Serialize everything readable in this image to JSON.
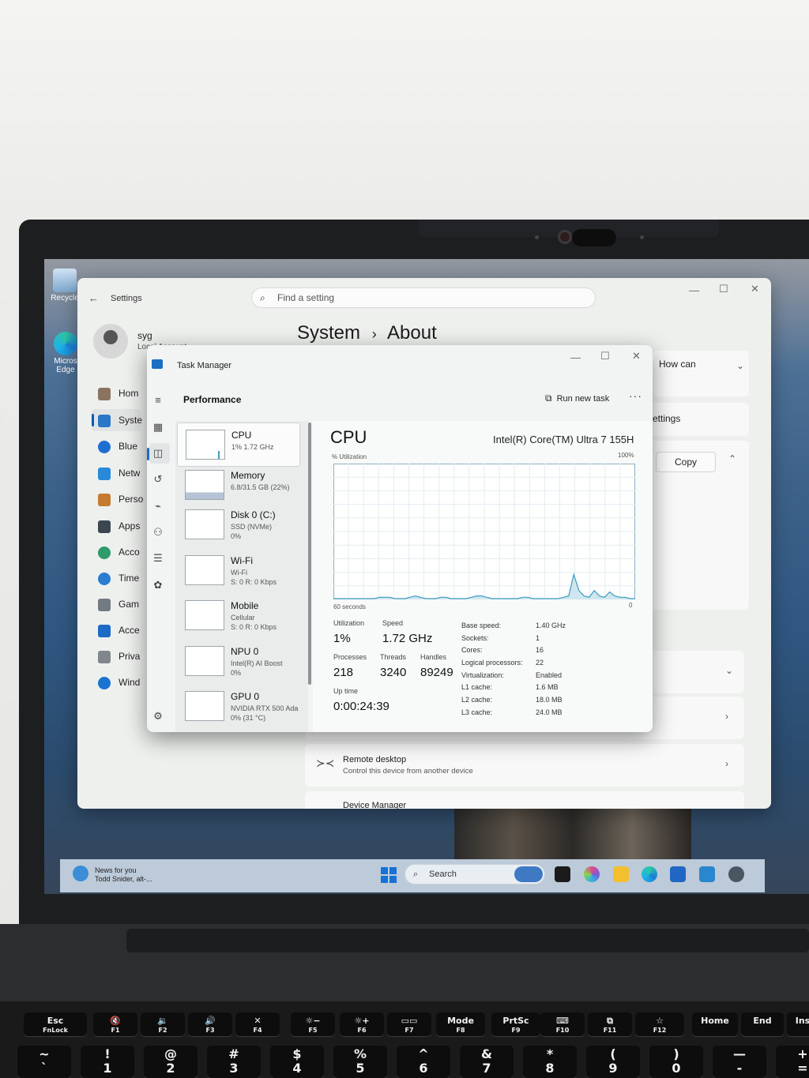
{
  "desktop": {
    "icons": [
      {
        "label": "Recycle",
        "icon": "recycle-bin-icon"
      },
      {
        "label": "Micros Edge",
        "icon": "edge-icon"
      }
    ]
  },
  "settings": {
    "title": "Settings",
    "search_placeholder": "Find a setting",
    "user_name": "syg",
    "user_sub": "Local Account",
    "breadcrumb_parent": "System",
    "breadcrumb_sep": "›",
    "breadcrumb_current": "About",
    "nav": [
      {
        "label": "Hom",
        "icon": "home-icon"
      },
      {
        "label": "Syste",
        "icon": "system-icon"
      },
      {
        "label": "Blue",
        "icon": "bluetooth-icon"
      },
      {
        "label": "Netw",
        "icon": "wifi-icon"
      },
      {
        "label": "Perso",
        "icon": "brush-icon"
      },
      {
        "label": "Apps",
        "icon": "apps-icon"
      },
      {
        "label": "Acco",
        "icon": "account-icon"
      },
      {
        "label": "Time",
        "icon": "clock-icon"
      },
      {
        "label": "Gam",
        "icon": "gamepad-icon"
      },
      {
        "label": "Acce",
        "icon": "accessibility-icon"
      },
      {
        "label": "Priva",
        "icon": "shield-icon"
      },
      {
        "label": "Wind",
        "icon": "update-icon"
      }
    ],
    "right_top_fragment": "How can",
    "settings_fragment": "settings",
    "copy_label": "Copy",
    "remote_desktop": {
      "title": "Remote desktop",
      "subtitle": "Control this device from another device"
    },
    "device_manager": "Device Manager"
  },
  "task_manager": {
    "title": "Task Manager",
    "section": "Performance",
    "run_new_task": "Run new task",
    "more": "···",
    "resources": [
      {
        "name": "CPU",
        "sub": [
          "1% 1.72 GHz"
        ]
      },
      {
        "name": "Memory",
        "sub": [
          "6.8/31.5 GB (22%)"
        ]
      },
      {
        "name": "Disk 0 (C:)",
        "sub": [
          "SSD (NVMe)",
          "0%"
        ]
      },
      {
        "name": "Wi-Fi",
        "sub": [
          "Wi-Fi",
          "S: 0 R: 0 Kbps"
        ]
      },
      {
        "name": "Mobile",
        "sub": [
          "Cellular",
          "S: 0 R: 0 Kbps"
        ]
      },
      {
        "name": "NPU 0",
        "sub": [
          "Intel(R) AI Boost",
          "0%"
        ]
      },
      {
        "name": "GPU 0",
        "sub": [
          "NVIDIA RTX 500 Ada",
          "0% (31 °C)"
        ]
      }
    ],
    "cpu": {
      "title": "CPU",
      "model": "Intel(R) Core(TM) Ultra 7 155H",
      "graph_label": "% Utilization",
      "graph_max": "100%",
      "graph_time": "60 seconds",
      "graph_zero": "0",
      "utilization_label": "Utilization",
      "utilization": "1%",
      "speed_label": "Speed",
      "speed": "1.72 GHz",
      "processes_label": "Processes",
      "processes": "218",
      "threads_label": "Threads",
      "threads": "3240",
      "handles_label": "Handles",
      "handles": "89249",
      "uptime_label": "Up time",
      "uptime": "0:00:24:39",
      "specs": [
        {
          "k": "Base speed:",
          "v": "1.40 GHz"
        },
        {
          "k": "Sockets:",
          "v": "1"
        },
        {
          "k": "Cores:",
          "v": "16"
        },
        {
          "k": "Logical processors:",
          "v": "22"
        },
        {
          "k": "Virtualization:",
          "v": "Enabled"
        },
        {
          "k": "L1 cache:",
          "v": "1.6 MB"
        },
        {
          "k": "L2 cache:",
          "v": "18.0 MB"
        },
        {
          "k": "L3 cache:",
          "v": "24.0 MB"
        }
      ],
      "history": [
        0,
        0,
        0,
        0,
        0,
        0,
        0,
        0,
        0,
        1,
        1,
        1,
        0,
        0,
        0,
        1,
        2,
        1,
        0,
        0,
        0,
        1,
        1,
        0,
        0,
        0,
        0,
        1,
        2,
        2,
        1,
        0,
        0,
        0,
        0,
        0,
        0,
        1,
        1,
        0,
        0,
        0,
        0,
        0,
        0,
        1,
        2,
        18,
        6,
        2,
        1,
        6,
        2,
        1,
        5,
        2,
        1,
        1,
        0,
        0
      ]
    }
  },
  "taskbar": {
    "news_line1": "News for you",
    "news_line2": "Todd Snider, alt-...",
    "search_label": "Search"
  },
  "keyboard": {
    "fn_row": [
      {
        "main": "Esc",
        "sub": "FnLock"
      },
      {
        "main": "🔇",
        "sub": "F1"
      },
      {
        "main": "🔉",
        "sub": "F2"
      },
      {
        "main": "🔊",
        "sub": "F3"
      },
      {
        "main": "✕",
        "sub": "F4"
      },
      {
        "main": "☼−",
        "sub": "F5"
      },
      {
        "main": "☼+",
        "sub": "F6"
      },
      {
        "main": "▭▭",
        "sub": "F7"
      },
      {
        "main": "Mode",
        "sub": "F8"
      },
      {
        "main": "PrtSc",
        "sub": "F9"
      },
      {
        "main": "⌨",
        "sub": "F10"
      },
      {
        "main": "⧉",
        "sub": "F11"
      },
      {
        "main": "☆",
        "sub": "F12"
      },
      {
        "main": "Home",
        "sub": ""
      },
      {
        "main": "End",
        "sub": ""
      },
      {
        "main": "Ins",
        "sub": ""
      }
    ],
    "num_row": [
      {
        "top": "~",
        "bottom": "`"
      },
      {
        "top": "!",
        "bottom": "1"
      },
      {
        "top": "@",
        "bottom": "2"
      },
      {
        "top": "#",
        "bottom": "3"
      },
      {
        "top": "$",
        "bottom": "4"
      },
      {
        "top": "%",
        "bottom": "5"
      },
      {
        "top": "^",
        "bottom": "6"
      },
      {
        "top": "&",
        "bottom": "7"
      },
      {
        "top": "*",
        "bottom": "8"
      },
      {
        "top": "(",
        "bottom": "9"
      },
      {
        "top": ")",
        "bottom": "0"
      },
      {
        "top": "—",
        "bottom": "-"
      },
      {
        "top": "+",
        "bottom": "="
      }
    ]
  }
}
